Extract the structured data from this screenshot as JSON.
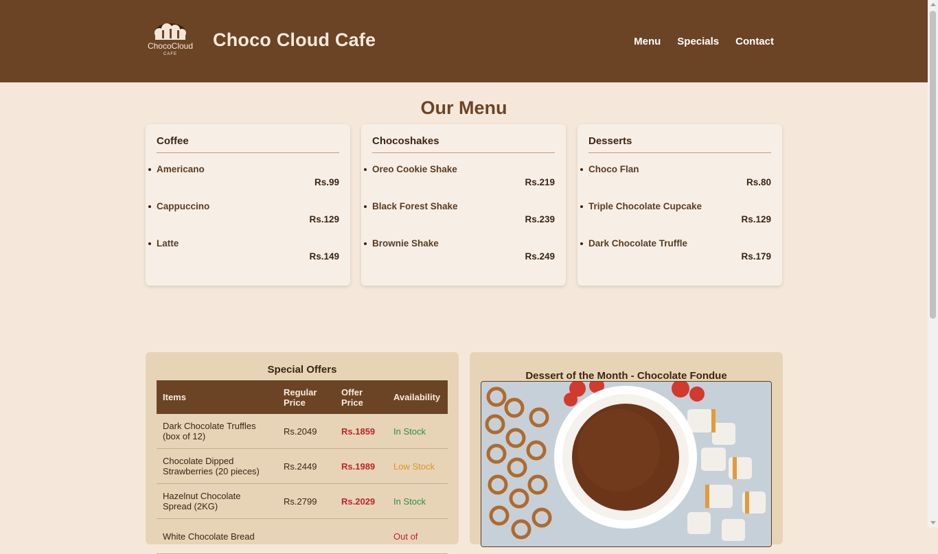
{
  "header": {
    "logo_text": "ChocoCloud",
    "logo_subtext": "CAFE",
    "title": "Choco Cloud Cafe",
    "nav": [
      "Menu",
      "Specials",
      "Contact"
    ]
  },
  "menu": {
    "title": "Our Menu",
    "categories": [
      {
        "name": "Coffee",
        "items": [
          {
            "name": "Americano",
            "price": "Rs.99"
          },
          {
            "name": "Cappuccino",
            "price": "Rs.129"
          },
          {
            "name": "Latte",
            "price": "Rs.149"
          }
        ]
      },
      {
        "name": "Chocoshakes",
        "items": [
          {
            "name": "Oreo Cookie Shake",
            "price": "Rs.219"
          },
          {
            "name": "Black Forest Shake",
            "price": "Rs.239"
          },
          {
            "name": "Brownie Shake",
            "price": "Rs.249"
          }
        ]
      },
      {
        "name": "Desserts",
        "items": [
          {
            "name": "Choco Flan",
            "price": "Rs.80"
          },
          {
            "name": "Triple Chocolate Cupcake",
            "price": "Rs.129"
          },
          {
            "name": "Dark Chocolate Truffle",
            "price": "Rs.179"
          }
        ]
      }
    ]
  },
  "specials": {
    "title": "Special Offers",
    "columns": [
      "Items",
      "Regular Price",
      "Offer Price",
      "Availability"
    ],
    "rows": [
      {
        "item": "Dark Chocolate Truffles (box of 12)",
        "regular": "Rs.2049",
        "offer": "Rs.1859",
        "availability": "In Stock",
        "status": "in"
      },
      {
        "item": "Chocolate Dipped Strawberries (20 pieces)",
        "regular": "Rs.2449",
        "offer": "Rs.1989",
        "availability": "Low Stock",
        "status": "low"
      },
      {
        "item": "Hazelnut Chocolate Spread (2KG)",
        "regular": "Rs.2799",
        "offer": "Rs.2029",
        "availability": "In Stock",
        "status": "in"
      },
      {
        "item": "White Chocolate Bread",
        "regular": "",
        "offer": "",
        "availability": "Out of",
        "status": "out"
      }
    ]
  },
  "dessert_of_month": {
    "title": "Dessert of the Month - Chocolate Fondue"
  },
  "colors": {
    "header_bg": "#6b4426",
    "page_bg": "#f5e8da",
    "accent_red": "#c0242a",
    "in_stock": "#2f8a4a",
    "low_stock": "#e8901c"
  }
}
